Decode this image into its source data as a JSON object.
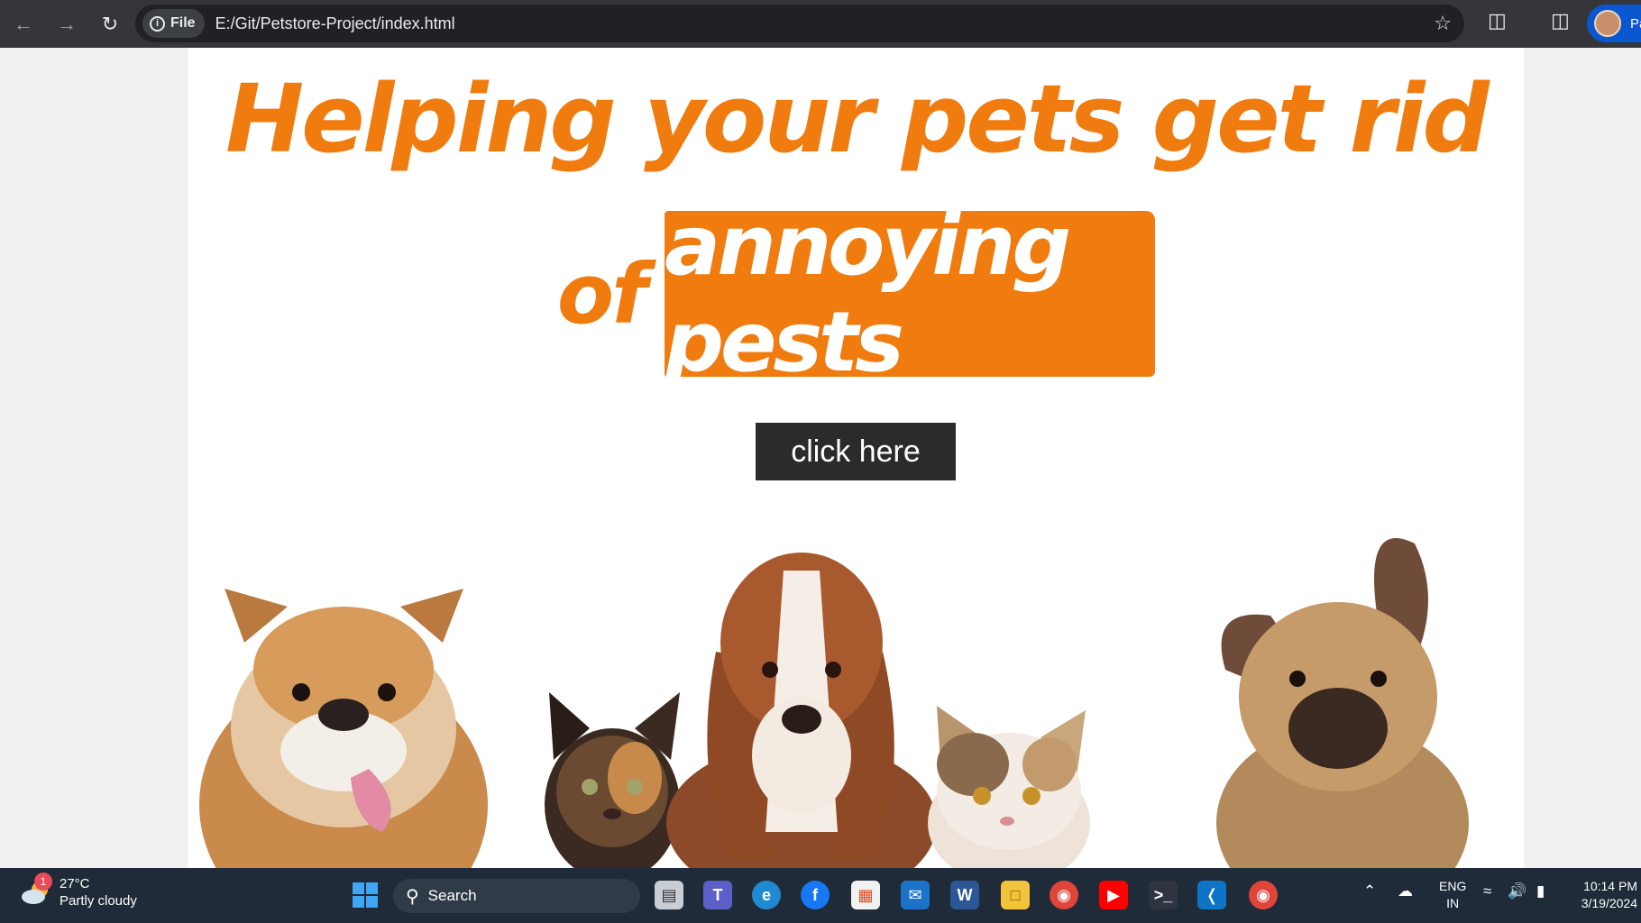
{
  "browser": {
    "file_chip_label": "File",
    "url": "E:/Git/Petstore-Project/index.html",
    "profile_label": "Pa"
  },
  "page": {
    "headline_line1": "Helping your pets get rid",
    "headline_line2_prefix": "of",
    "headline_highlight": "annoying pests",
    "cta_label": "click here",
    "accent_color": "#f07c10",
    "button_color": "#2b2b2b"
  },
  "taskbar": {
    "weather_badge": "1",
    "temperature": "27°C",
    "condition": "Partly cloudy",
    "search_label": "Search",
    "lang_line1": "ENG",
    "lang_line2": "IN",
    "time": "10:14 PM",
    "date": "3/19/2024",
    "apps": [
      "task-view",
      "teams",
      "edge",
      "facebook",
      "microsoft-store",
      "mail",
      "word",
      "file-explorer",
      "chrome",
      "youtube",
      "terminal",
      "vscode",
      "chrome-profile"
    ]
  }
}
